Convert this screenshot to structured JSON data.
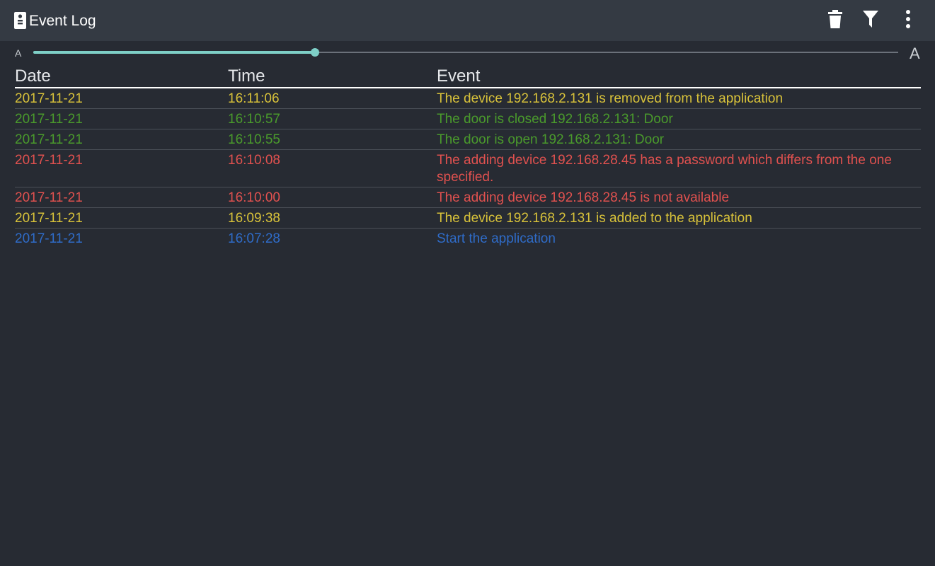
{
  "appbar": {
    "title": "Event Log",
    "icon": "doorbell-icon",
    "actions": [
      {
        "name": "delete",
        "icon": "trash-icon"
      },
      {
        "name": "filter",
        "icon": "filter-icon"
      },
      {
        "name": "more",
        "icon": "more-vert-icon"
      }
    ]
  },
  "font_slider": {
    "small_label": "A",
    "large_label": "A",
    "value_fraction": 0.326,
    "accent_color": "#7ecfc7"
  },
  "table": {
    "headers": {
      "date": "Date",
      "time": "Time",
      "event": "Event"
    },
    "rows": [
      {
        "date": "2017-11-21",
        "time": "16:11:06",
        "event": "The device 192.168.2.131 is removed from the application",
        "color": "#d8c23a"
      },
      {
        "date": "2017-11-21",
        "time": "16:10:57",
        "event": "The door is closed 192.168.2.131: Door",
        "color": "#4a9a2c"
      },
      {
        "date": "2017-11-21",
        "time": "16:10:55",
        "event": "The door is open 192.168.2.131: Door",
        "color": "#4a9a2c"
      },
      {
        "date": "2017-11-21",
        "time": "16:10:08",
        "event": "The adding device 192.168.28.45 has a password which differs from the one specified.",
        "color": "#e0514f"
      },
      {
        "date": "2017-11-21",
        "time": "16:10:00",
        "event": "The adding device 192.168.28.45 is not available",
        "color": "#e0514f"
      },
      {
        "date": "2017-11-21",
        "time": "16:09:38",
        "event": "The device 192.168.2.131 is added to the application",
        "color": "#d8c23a"
      },
      {
        "date": "2017-11-21",
        "time": "16:07:28",
        "event": "Start the application",
        "color": "#2f6cc9"
      }
    ]
  }
}
